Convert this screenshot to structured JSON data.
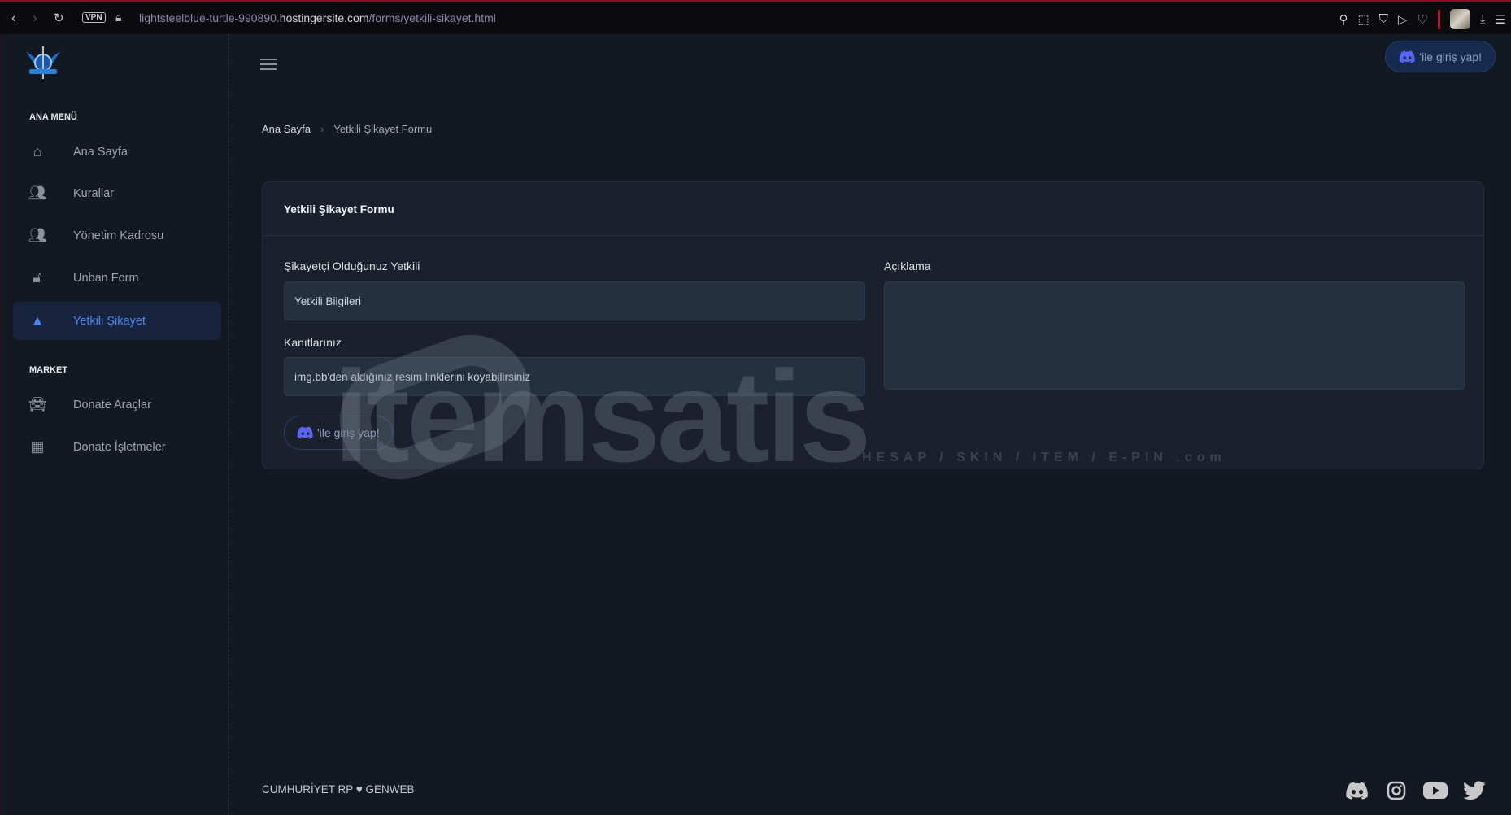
{
  "browser": {
    "url_prefix": "lightsteelblue-turtle-990890.",
    "url_domain": "hostingersite.com",
    "url_path": "/forms/yetkili-sikayet.html",
    "vpn": "VPN"
  },
  "sidebar": {
    "sections": [
      {
        "title": "ANA MENÜ"
      },
      {
        "title": "MARKET"
      }
    ],
    "items": [
      {
        "label": "Ana Sayfa",
        "icon": "home-icon"
      },
      {
        "label": "Kurallar",
        "icon": "users-cog-icon"
      },
      {
        "label": "Yönetim Kadrosu",
        "icon": "users-cog-icon"
      },
      {
        "label": "Unban Form",
        "icon": "unlock-icon"
      },
      {
        "label": "Yetkili Şikayet",
        "icon": "warning-icon",
        "active": true
      },
      {
        "label": "Donate Araçlar",
        "icon": "car-icon"
      },
      {
        "label": "Donate İşletmeler",
        "icon": "building-icon"
      }
    ]
  },
  "header": {
    "login_label": "'ile giriş yap!"
  },
  "breadcrumb": {
    "home": "Ana Sayfa",
    "current": "Yetkili Şikayet Formu"
  },
  "form": {
    "title": "Yetkili Şikayet Formu",
    "field1_label": "Şikayetçi Olduğunuz Yetkili",
    "field1_placeholder": "Yetkili Bilgileri",
    "field2_label": "Kanıtlarınız",
    "field2_placeholder": "img.bb'den aldığınız resim linklerini koyabilirsiniz",
    "field3_label": "Açıklama",
    "login_label": "'ile giriş yap!"
  },
  "watermark": {
    "text": "itemsatis",
    "sub": "HESAP / SKIN / ITEM / E-PIN .com"
  },
  "footer": {
    "text": "CUMHURİYET RP ♥ GENWEB"
  },
  "colors": {
    "accent": "#4a86f2",
    "discord": "#5865f2"
  }
}
